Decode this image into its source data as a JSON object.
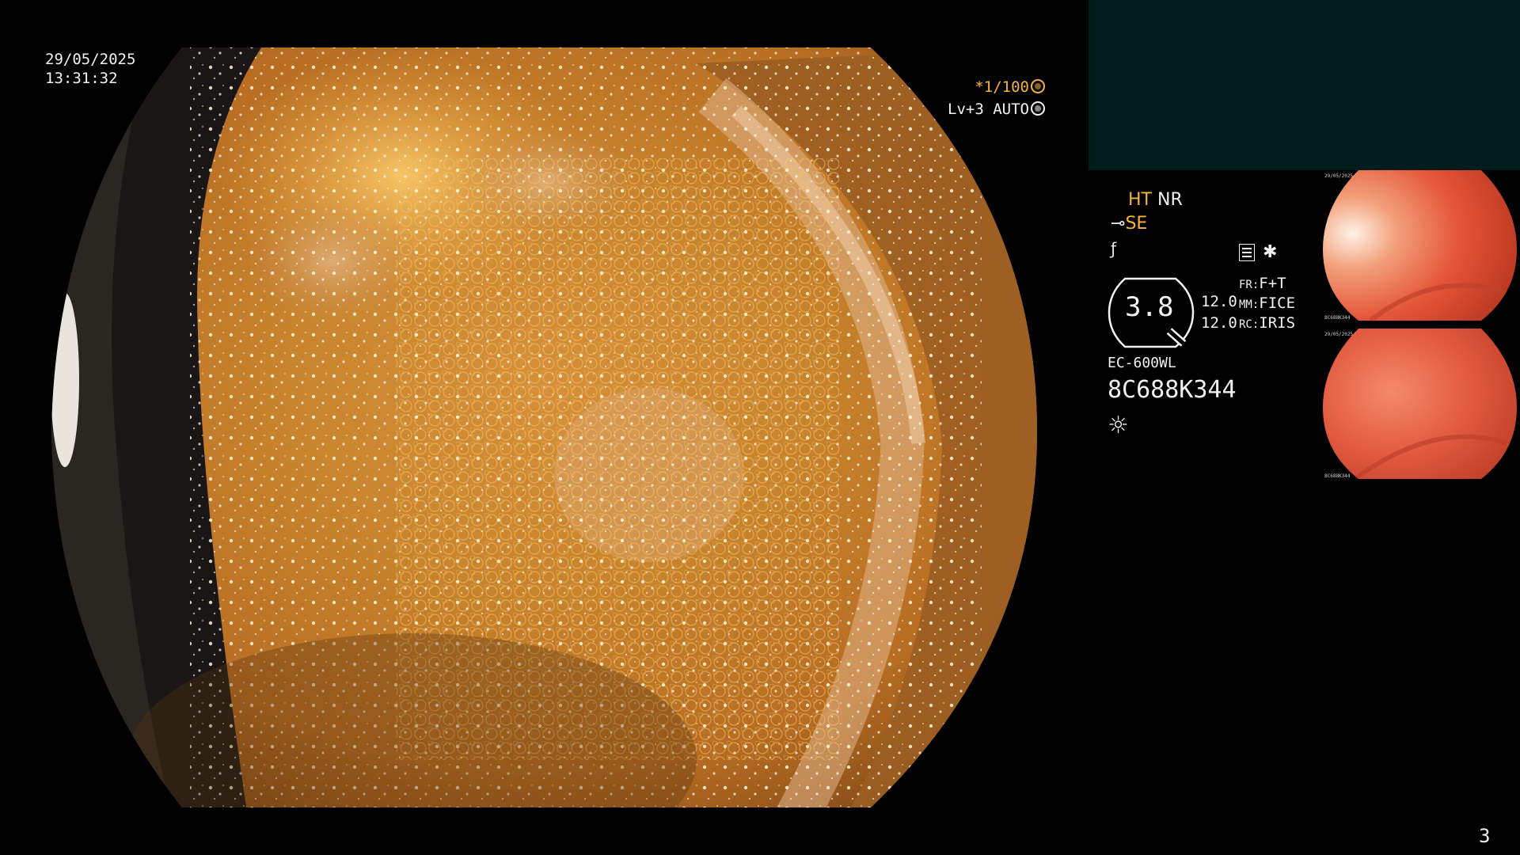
{
  "overlay": {
    "date": "29/05/2025",
    "time": "13:31:32",
    "shutter": "*1/100",
    "level": "Lv+3 AUTO"
  },
  "info_panel": {
    "ht": "HT",
    "nr": "NR",
    "se": "SE",
    "gauge_value": "3.8",
    "num_top": "12.0",
    "num_bottom": "12.0",
    "fr_key": "FR:",
    "fr_val": "F+T",
    "mm_key": "MM:",
    "mm_val": "FICE",
    "rc_key": "RC:",
    "rc_val": "IRIS",
    "model": "EC-600WL",
    "serial": "8C688K344"
  },
  "thumbnails": [
    {
      "date": "29/05/2025",
      "serial": "8C688K344"
    },
    {
      "date": "29/05/2025",
      "serial": "8C688K344"
    }
  ],
  "page_number": "3",
  "colors": {
    "accent_orange": "#f6b33a",
    "panel_teal": "#011c1c",
    "thumb_red": "#e5553a"
  },
  "icons": [
    "shutter-ring-icon",
    "auto-ring-icon",
    "scope-tip-icon",
    "freeze-icon",
    "menu-list-icon",
    "star-icon",
    "gauge-icon",
    "light-sun-icon"
  ]
}
